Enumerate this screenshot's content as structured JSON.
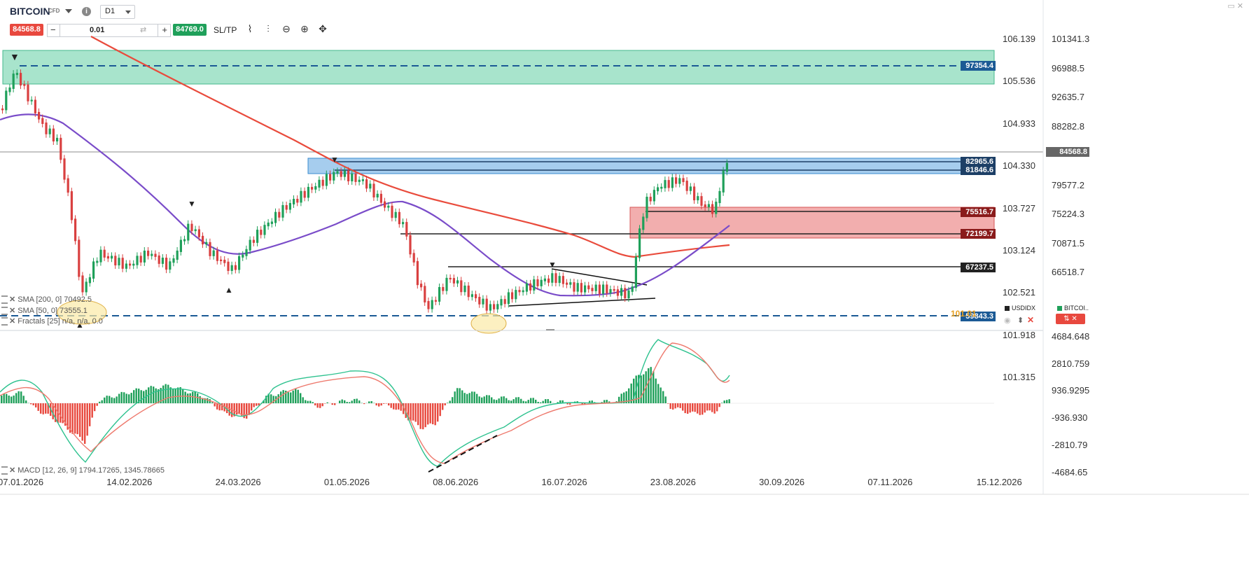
{
  "header": {
    "symbol": "BITCOIN",
    "symbol_type": "CFD",
    "info_icon": "info-icon",
    "timeframe": "D1"
  },
  "trade_bar": {
    "sell_price": "84568.8",
    "buy_price": "84769.0",
    "quantity": "0.01",
    "minus": "−",
    "plus": "+",
    "sltp_label": "SL/TP"
  },
  "price_axis": {
    "left_labels": [
      "106.139",
      "105.536",
      "104.933",
      "104.330",
      "103.727",
      "103.124",
      "102.521",
      "101.918",
      "101.315"
    ],
    "right_labels": [
      "101341.3",
      "96988.5",
      "92635.7",
      "88282.8",
      "79577.2",
      "75224.3",
      "70871.5",
      "66518.7"
    ]
  },
  "price_tags": {
    "current": "84568.8",
    "levels": [
      "97354.4",
      "82965.6",
      "81846.6",
      "75516.7",
      "72199.7",
      "67237.5",
      "59843.3"
    ],
    "overlap_text": "101.01"
  },
  "macd_axis": [
    "4684.648",
    "2810.759",
    "936.9295",
    "-936.930",
    "-2810.79",
    "-4684.65"
  ],
  "date_axis": [
    "07.01.2026",
    "14.02.2026",
    "24.03.2026",
    "01.05.2026",
    "08.06.2026",
    "16.07.2026",
    "23.08.2026",
    "30.09.2026",
    "07.11.2026",
    "15.12.2026"
  ],
  "indicators": [
    "SMA [200, 0] 70492.5",
    "SMA [50, 0] 73555.1",
    "Fractals [25] n/a, n/a, 0.0"
  ],
  "macd_legend": "MACD [12, 26, 9] 1794.17265, 1345.78665",
  "badges": {
    "usdidx": "USDIDX",
    "bitcoin": "BITCOI.."
  },
  "colors": {
    "sell": "#e8483e",
    "buy": "#1fa05a",
    "green_zone": "#8ad9bd",
    "blue_zone": "#9ac7ea",
    "red_zone": "#ee9e9e",
    "sma200": "#e94b3c",
    "sma50": "#7a4cc9",
    "macd_pos": "#1fa05a",
    "macd_neg": "#e8483e"
  }
}
